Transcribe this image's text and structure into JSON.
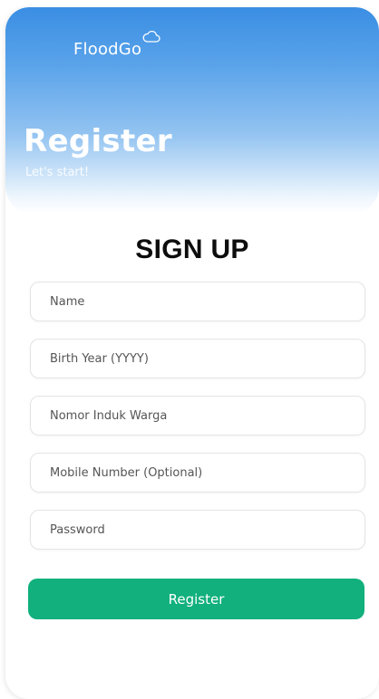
{
  "header": {
    "app_name": "FloodGo",
    "logo_icon": "cloud-icon",
    "title": "Register",
    "subtitle": "Let's start!"
  },
  "form": {
    "heading": "SIGN UP",
    "fields": [
      {
        "placeholder": "Name",
        "value": ""
      },
      {
        "placeholder": "Birth Year (YYYY)",
        "value": ""
      },
      {
        "placeholder": "Nomor Induk Warga",
        "value": ""
      },
      {
        "placeholder": "Mobile Number (Optional)",
        "value": ""
      },
      {
        "placeholder": "Password",
        "value": ""
      }
    ],
    "submit_label": "Register"
  },
  "colors": {
    "header_gradient_top": "#3a8ee3",
    "header_gradient_bottom": "#ffffff",
    "button": "#11b07c",
    "heading": "#0d0d0d"
  }
}
